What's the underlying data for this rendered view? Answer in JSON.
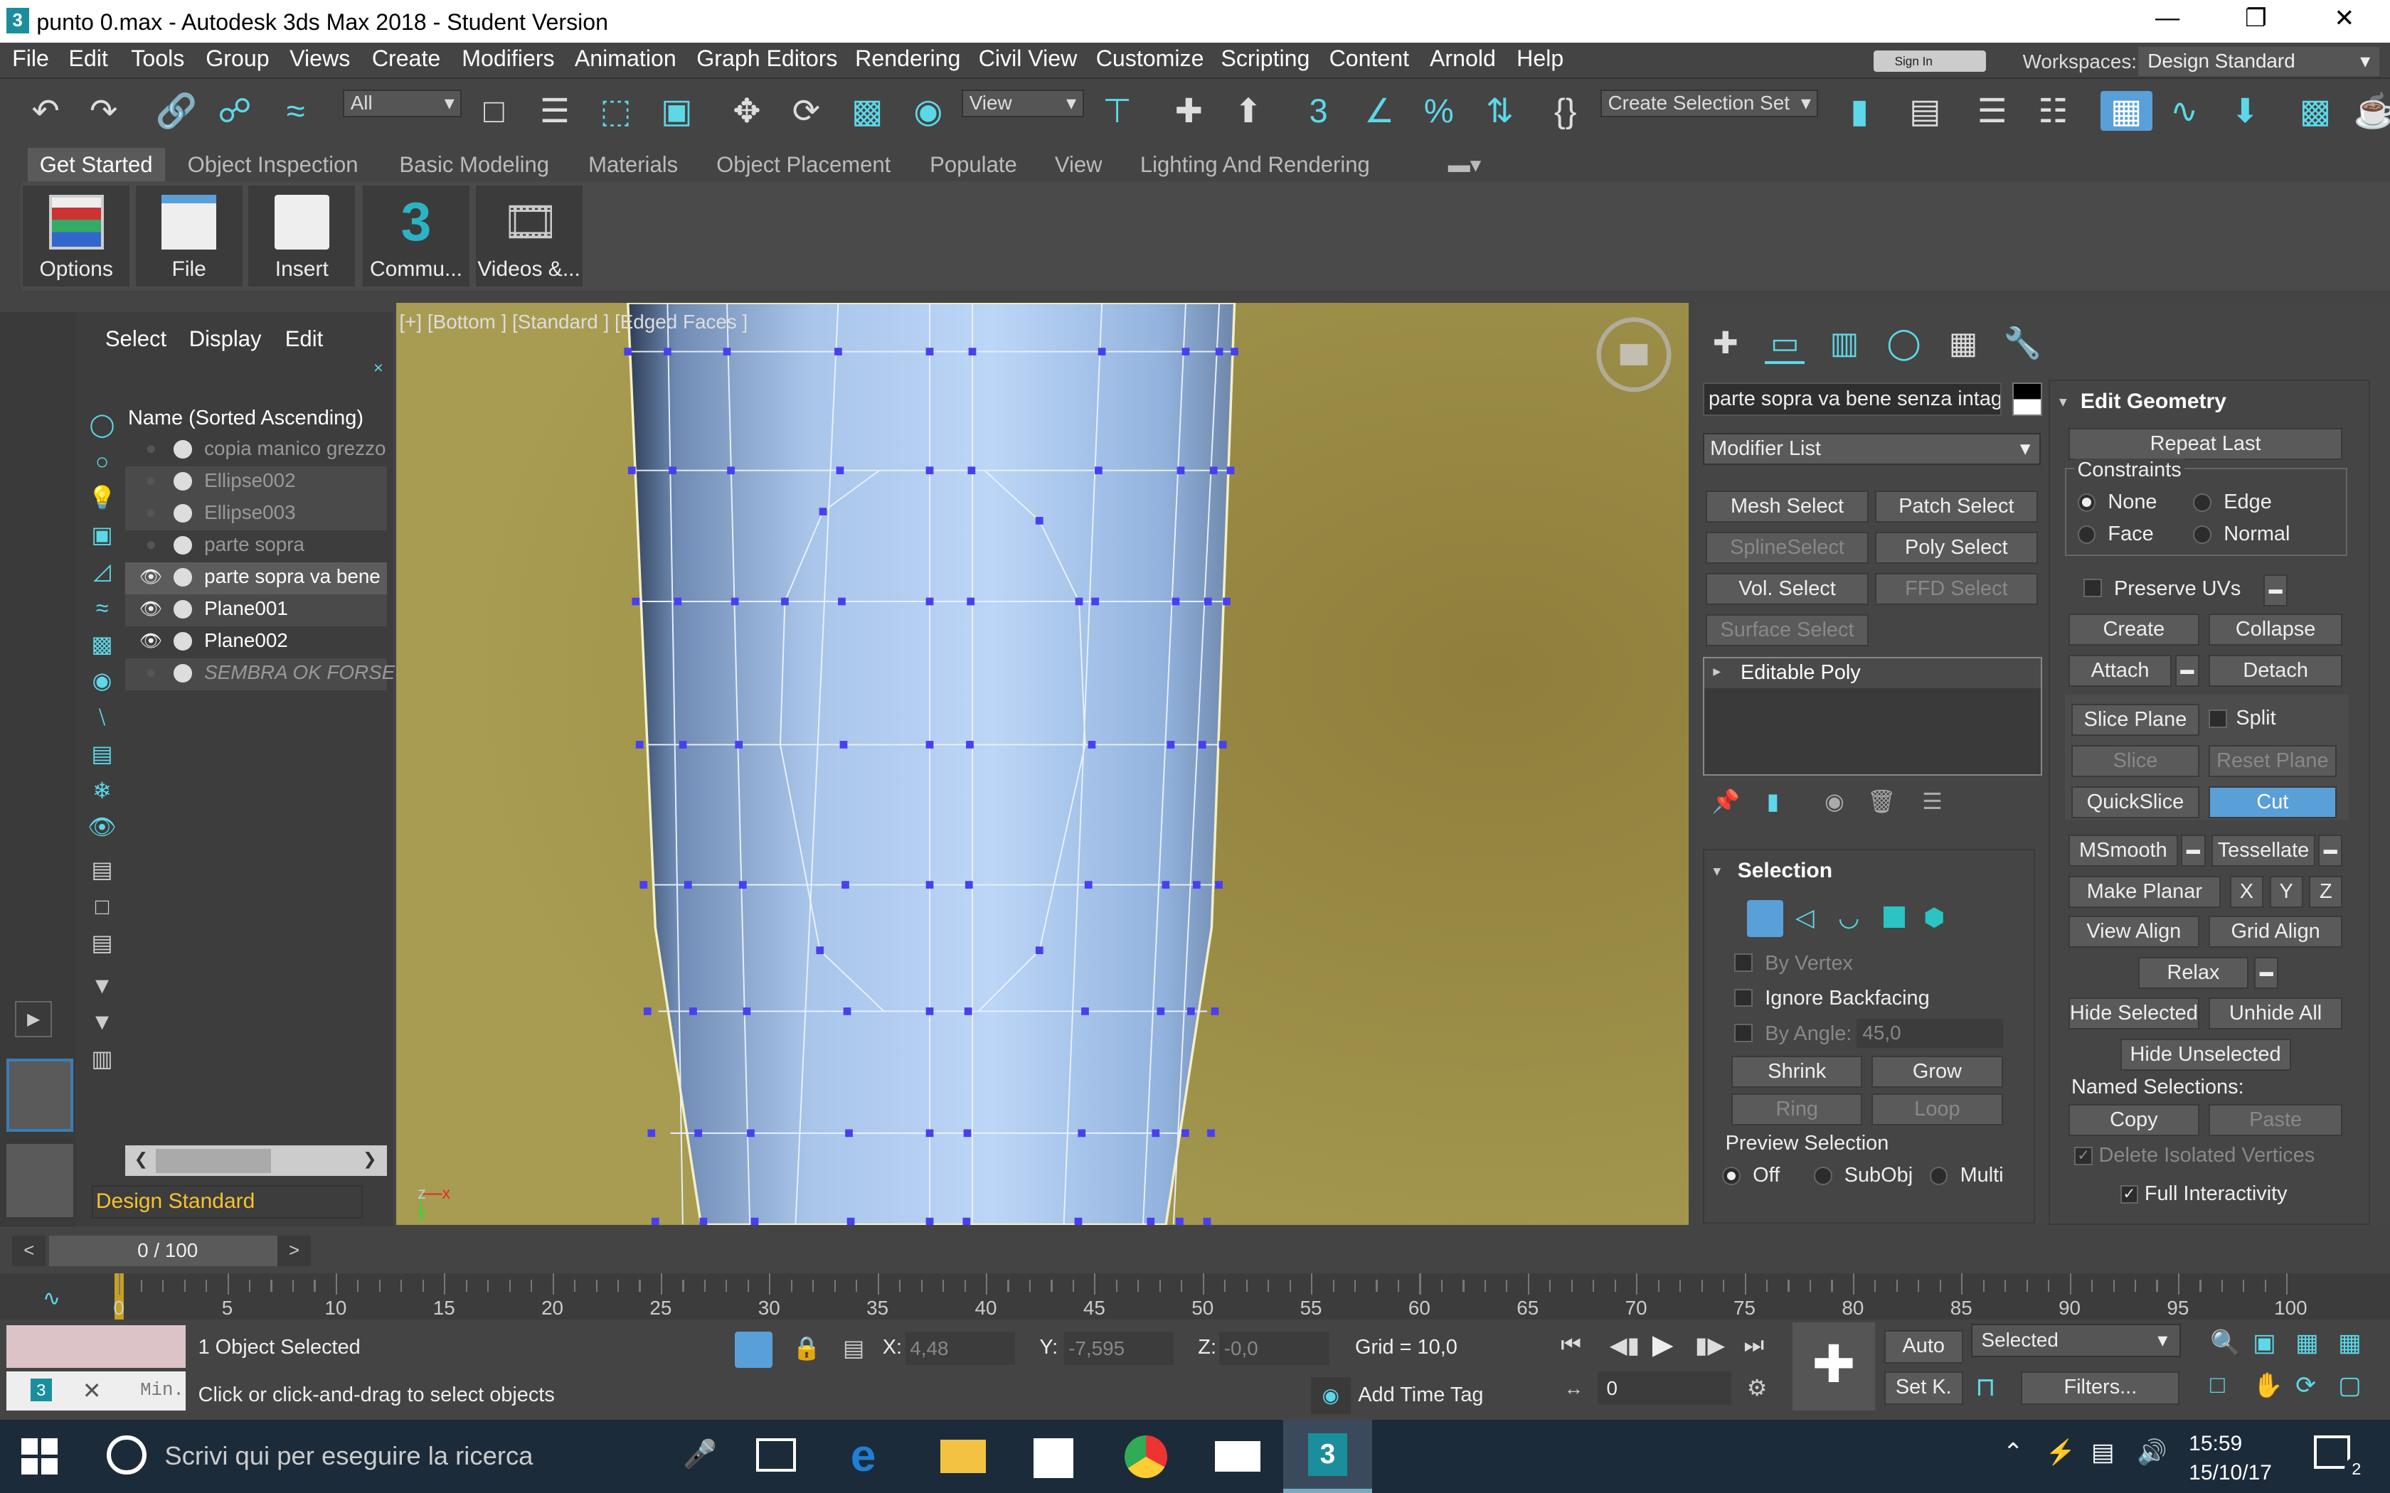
{
  "window": {
    "title": "punto 0.max - Autodesk 3ds Max 2018 - Student Version",
    "app_icon": "3"
  },
  "menu": [
    "File",
    "Edit",
    "Tools",
    "Group",
    "Views",
    "Create",
    "Modifiers",
    "Animation",
    "Graph Editors",
    "Rendering",
    "Civil View",
    "Customize",
    "Scripting",
    "Content",
    "Arnold",
    "Help"
  ],
  "signin": "Sign In",
  "workspaces": {
    "label": "Workspaces:",
    "value": "Design Standard"
  },
  "toolbar": {
    "filter": "All",
    "ref_coord": "View",
    "selection_set": "Create Selection Set"
  },
  "ribbon": {
    "tabs": [
      "Get Started",
      "Object Inspection",
      "Basic Modeling",
      "Materials",
      "Object Placement",
      "Populate",
      "View",
      "Lighting And Rendering"
    ],
    "buttons": [
      "Options",
      "File",
      "Insert",
      "Commu...",
      "Videos &..."
    ]
  },
  "scene_explorer": {
    "menus": [
      "Select",
      "Display",
      "Edit"
    ],
    "column_header": "Name (Sorted Ascending)",
    "items": [
      "copia manico grezzo",
      "Ellipse002",
      "Ellipse003",
      "parte sopra",
      "parte sopra va bene",
      "Plane001",
      "Plane002",
      "SEMBRA OK FORSE"
    ],
    "workspace": "Design Standard"
  },
  "viewport": {
    "label": "[+] [Bottom ] [Standard ] [Edged Faces ]",
    "axis_z": "z",
    "axis_x": "x",
    "axis_y": "y"
  },
  "command_panel": {
    "object_name": "parte sopra va bene senza intagli",
    "modifier_list": "Modifier List",
    "modifier_buttons": [
      "Mesh Select",
      "Patch Select",
      "SplineSelect",
      "Poly Select",
      "Vol. Select",
      "FFD Select",
      "Surface Select"
    ],
    "stack_item": "Editable Poly",
    "selection": {
      "title": "Selection",
      "by_vertex": "By Vertex",
      "ignore_backfacing": "Ignore Backfacing",
      "by_angle": "By Angle:",
      "angle_value": "45,0",
      "shrink": "Shrink",
      "grow": "Grow",
      "ring": "Ring",
      "loop": "Loop",
      "preview": "Preview Selection",
      "preview_options": [
        "Off",
        "SubObj",
        "Multi"
      ]
    },
    "edit_geometry": {
      "title": "Edit Geometry",
      "repeat_last": "Repeat Last",
      "constraints": "Constraints",
      "constraint_options": [
        "None",
        "Edge",
        "Face",
        "Normal"
      ],
      "preserve_uvs": "Preserve UVs",
      "create": "Create",
      "collapse": "Collapse",
      "attach": "Attach",
      "detach": "Detach",
      "slice_plane": "Slice Plane",
      "split": "Split",
      "slice": "Slice",
      "reset_plane": "Reset Plane",
      "quickslice": "QuickSlice",
      "cut": "Cut",
      "msmooth": "MSmooth",
      "tessellate": "Tessellate",
      "make_planar": "Make Planar",
      "x": "X",
      "y": "Y",
      "z": "Z",
      "view_align": "View Align",
      "grid_align": "Grid Align",
      "relax": "Relax",
      "hide_selected": "Hide Selected",
      "unhide_all": "Unhide All",
      "hide_unselected": "Hide Unselected",
      "named_selections": "Named Selections:",
      "copy": "Copy",
      "paste": "Paste",
      "delete_isolated": "Delete Isolated Vertices",
      "full_interactivity": "Full Interactivity"
    }
  },
  "timeline": {
    "frame": "0 / 100",
    "ticks": [
      "0",
      "5",
      "10",
      "15",
      "20",
      "25",
      "30",
      "35",
      "40",
      "45",
      "50",
      "55",
      "60",
      "65",
      "70",
      "75",
      "80",
      "85",
      "90",
      "95",
      "100"
    ]
  },
  "status": {
    "objects": "1 Object Selected",
    "prompt": "Click or click-and-drag to select objects",
    "x_label": "X:",
    "x": "4,48",
    "y_label": "Y:",
    "y": "-7,595",
    "z_label": "Z:",
    "z": "-0,0",
    "grid": "Grid = 10,0",
    "add_time_tag": "Add Time Tag",
    "auto": "Auto",
    "setk": "Set K.",
    "selected": "Selected",
    "filters": "Filters...",
    "frame_field": "0",
    "mini": "Min."
  },
  "taskbar": {
    "search": "Scrivi qui per eseguire la ricerca",
    "time": "15:59",
    "date": "15/10/17",
    "notifications": "2"
  }
}
